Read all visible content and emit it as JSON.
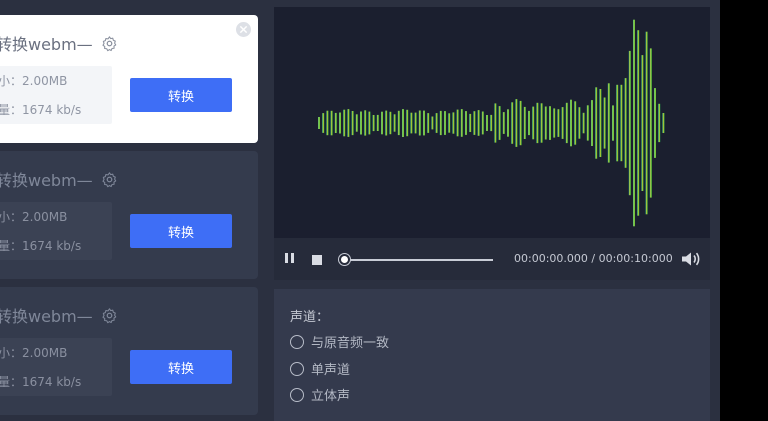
{
  "files": [
    {
      "title": "转换webm—",
      "size": "小：2.00MB",
      "bitrate": "量：1674 kb/s",
      "button": "转换",
      "active": true
    },
    {
      "title": "转换webm—",
      "size": "小：2.00MB",
      "bitrate": "量：1674 kb/s",
      "button": "转换",
      "active": false
    },
    {
      "title": "转换webm—",
      "size": "小：2.00MB",
      "bitrate": "量：1674 kb/s",
      "button": "转换",
      "active": false
    }
  ],
  "player": {
    "time": "00:00:00.000 / 00:00:10:000",
    "progress_percent": 0
  },
  "settings": {
    "channel_label": "声道：",
    "options": [
      "与原音频一致",
      "单声道",
      "立体声"
    ]
  },
  "icons": {
    "gear": "gear-icon",
    "close": "close-icon",
    "pause": "pause-icon",
    "stop": "stop-icon",
    "volume": "volume-icon",
    "radio": "radio-icon"
  },
  "colors": {
    "accent": "#3e6ef6",
    "wave_start": "#17b8a0",
    "wave_mid": "#c9c629",
    "wave_end": "#26c247"
  }
}
